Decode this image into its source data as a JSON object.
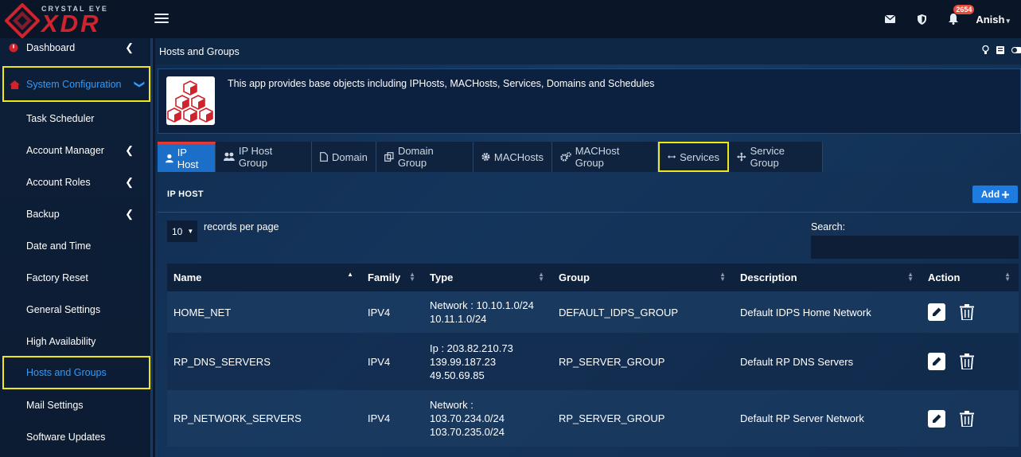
{
  "brand": {
    "top": "CRYSTAL EYE",
    "main": "XDR"
  },
  "topbar": {
    "notification_count": "2654",
    "user": "Anish",
    "icons": [
      "envelope-icon",
      "shield-icon",
      "bell-icon"
    ]
  },
  "sidebar": {
    "items": [
      {
        "label": "Dashboard",
        "chev": "❮"
      },
      {
        "label": "System Configuration",
        "chev": "❯"
      },
      {
        "label": "Task Scheduler",
        "chev": ""
      },
      {
        "label": "Account Manager",
        "chev": "❮"
      },
      {
        "label": "Account Roles",
        "chev": "❮"
      },
      {
        "label": "Backup",
        "chev": "❮"
      },
      {
        "label": "Date and Time",
        "chev": ""
      },
      {
        "label": "Factory Reset",
        "chev": ""
      },
      {
        "label": "General Settings",
        "chev": ""
      },
      {
        "label": "High Availability",
        "chev": ""
      },
      {
        "label": "Hosts and Groups",
        "chev": ""
      },
      {
        "label": "Mail Settings",
        "chev": ""
      },
      {
        "label": "Software Updates",
        "chev": ""
      }
    ]
  },
  "page": {
    "title": "Hosts and Groups",
    "info": "This app provides base objects including IPHosts, MACHosts, Services, Domains and Schedules"
  },
  "tabs": [
    {
      "label": "IP Host"
    },
    {
      "label": "IP Host Group"
    },
    {
      "label": "Domain"
    },
    {
      "label": "Domain Group"
    },
    {
      "label": "MACHosts"
    },
    {
      "label": "MACHost Group"
    },
    {
      "label": "Services"
    },
    {
      "label": "Service Group"
    }
  ],
  "panel": {
    "title": "IP HOST",
    "add_label": "Add",
    "records_value": "10",
    "records_label": "records per page",
    "search_label": "Search:"
  },
  "table": {
    "headers": [
      "Name",
      "Family",
      "Type",
      "Group",
      "Description",
      "Action"
    ],
    "rows": [
      {
        "name": "HOME_NET",
        "family": "IPV4",
        "type1": "Network : 10.10.1.0/24",
        "type2": "10.11.1.0/24",
        "type3": "",
        "group": "DEFAULT_IDPS_GROUP",
        "description": "Default IDPS Home Network"
      },
      {
        "name": "RP_DNS_SERVERS",
        "family": "IPV4",
        "type1": "Ip : 203.82.210.73",
        "type2": "139.99.187.23",
        "type3": "49.50.69.85",
        "group": "RP_SERVER_GROUP",
        "description": "Default RP DNS Servers"
      },
      {
        "name": "RP_NETWORK_SERVERS",
        "family": "IPV4",
        "type1": "Network :",
        "type2": "103.70.234.0/24",
        "type3": "103.70.235.0/24",
        "group": "RP_SERVER_GROUP",
        "description": "Default RP Server Network"
      }
    ]
  }
}
